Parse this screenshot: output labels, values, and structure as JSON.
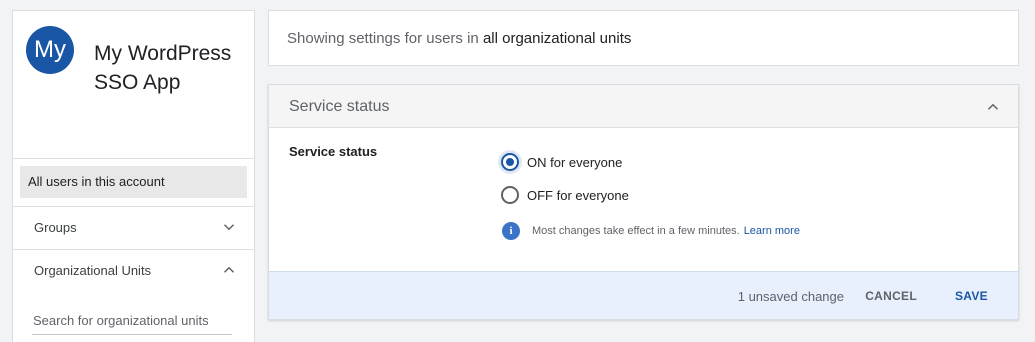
{
  "app": {
    "avatar_text": "My",
    "name": "My WordPress SSO App"
  },
  "sidebar": {
    "all_users": "All users in this account",
    "groups": "Groups",
    "organizational_units": "Organizational Units",
    "ou_search_placeholder": "Search for organizational units"
  },
  "info": {
    "prefix": "Showing settings for users in",
    "scope": "all organizational units"
  },
  "service": {
    "header_title": "Service status",
    "label": "Service status",
    "options": [
      {
        "label": "ON for everyone",
        "selected": true
      },
      {
        "label": "OFF for everyone",
        "selected": false
      }
    ],
    "note": "Most changes take effect in a few minutes.",
    "learn_more": "Learn more"
  },
  "footer": {
    "unsaved": "1 unsaved change",
    "cancel": "CANCEL",
    "save": "SAVE"
  },
  "colors": {
    "accent": "#1a56a6",
    "footer_bg": "#e8f0fe"
  },
  "icons": {
    "groups_toggle": "chevron-down-icon",
    "ou_toggle": "chevron-up-icon",
    "service_collapse": "chevron-up-icon",
    "note": "info-icon"
  }
}
